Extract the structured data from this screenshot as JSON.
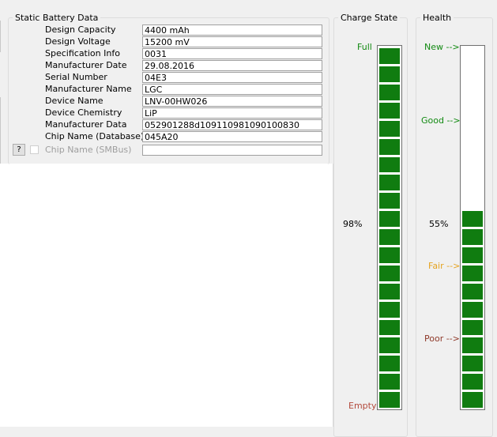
{
  "static_battery": {
    "title": "Static Battery Data",
    "rows": [
      {
        "label": "Design Capacity",
        "value": "4400 mAh"
      },
      {
        "label": "Design Voltage",
        "value": "15200 mV"
      },
      {
        "label": "Specification Info",
        "value": "0031"
      },
      {
        "label": "Manufacturer Date",
        "value": "29.08.2016"
      },
      {
        "label": "Serial Number",
        "value": "04E3"
      },
      {
        "label": "Manufacturer Name",
        "value": "LGC"
      },
      {
        "label": "Device Name",
        "value": "LNV-00HW026"
      },
      {
        "label": "Device Chemistry",
        "value": "LiP"
      },
      {
        "label": "Manufacturer Data",
        "value": "052901288d109110981090100830"
      },
      {
        "label": "Chip Name (Database)",
        "value": "045A20"
      }
    ],
    "smbus": {
      "help_label": "?",
      "label": "Chip Name (SMBus)",
      "value": "",
      "checked": false
    }
  },
  "charge_state": {
    "title": "Charge State",
    "full_label": "Full",
    "empty_label": "Empty",
    "percent_text": "98%",
    "level": 0.98
  },
  "health": {
    "title": "Health",
    "new_label": "New -->",
    "good_label": "Good -->",
    "fair_label": "Fair -->",
    "poor_label": "Poor -->",
    "percent_text": "55%",
    "level": 0.55
  },
  "colors": {
    "bar_fill": "#107c10",
    "full_label": "#128a12",
    "empty_label": "#b34a3c",
    "fair_label": "#e5a320",
    "poor_label": "#8f3a2a"
  }
}
